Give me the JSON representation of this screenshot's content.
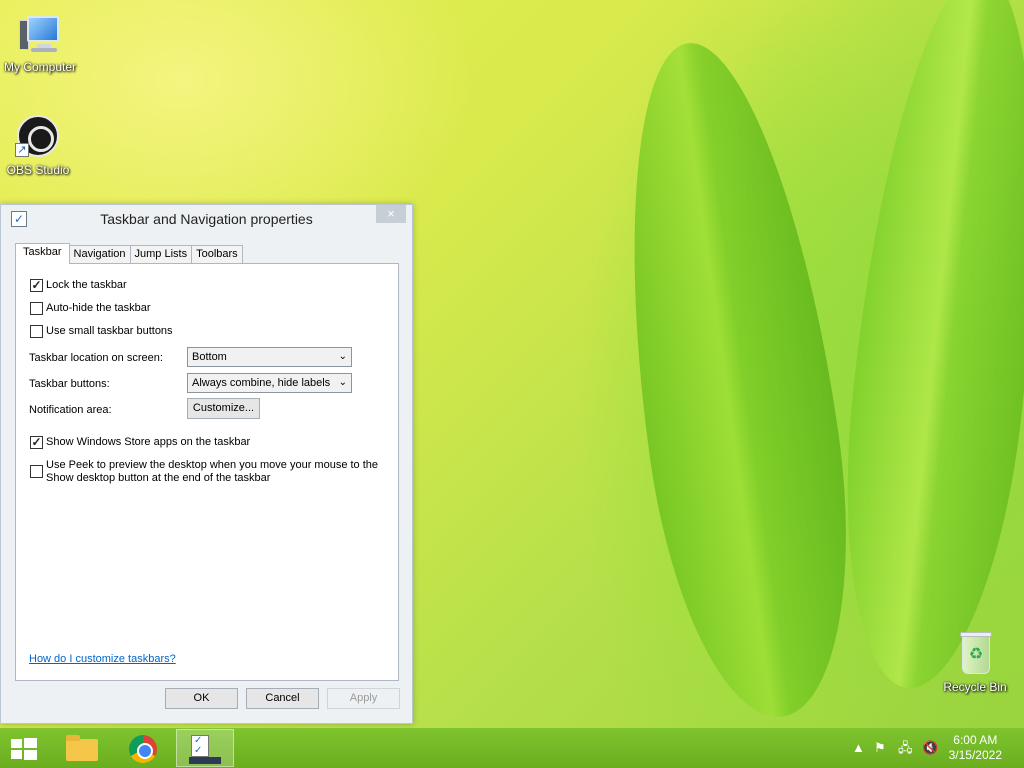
{
  "desktop": {
    "icons": {
      "my_computer": "My Computer",
      "obs_studio": "OBS Studio",
      "recycle_bin": "Recycle Bin"
    }
  },
  "dialog": {
    "title": "Taskbar and Navigation properties",
    "close_symbol": "×",
    "tabs": [
      "Taskbar",
      "Navigation",
      "Jump Lists",
      "Toolbars"
    ],
    "active_tab": "Taskbar",
    "checkboxes": {
      "lock_taskbar": {
        "label": "Lock the taskbar",
        "checked": true
      },
      "auto_hide": {
        "label": "Auto-hide the taskbar",
        "checked": false
      },
      "small_buttons": {
        "label": "Use small taskbar buttons",
        "checked": false
      },
      "store_apps": {
        "label": "Show Windows Store apps on the taskbar",
        "checked": true
      },
      "peek": {
        "label": "Use Peek to preview the desktop when you move your mouse to the Show desktop button at the end of the taskbar",
        "checked": false
      }
    },
    "fields": {
      "location_label": "Taskbar location on screen:",
      "location_value": "Bottom",
      "buttons_label": "Taskbar buttons:",
      "buttons_value": "Always combine, hide labels",
      "notification_label": "Notification area:",
      "customize_button": "Customize..."
    },
    "help_link": "How do I customize taskbars?",
    "footer": {
      "ok": "OK",
      "cancel": "Cancel",
      "apply": "Apply"
    }
  },
  "taskbar": {
    "clock_time": "6:00 AM",
    "clock_date": "3/15/2022",
    "tray_chevron": "▲"
  },
  "colors": {
    "accent_link": "#0066cc",
    "taskbar": "#72b626"
  }
}
